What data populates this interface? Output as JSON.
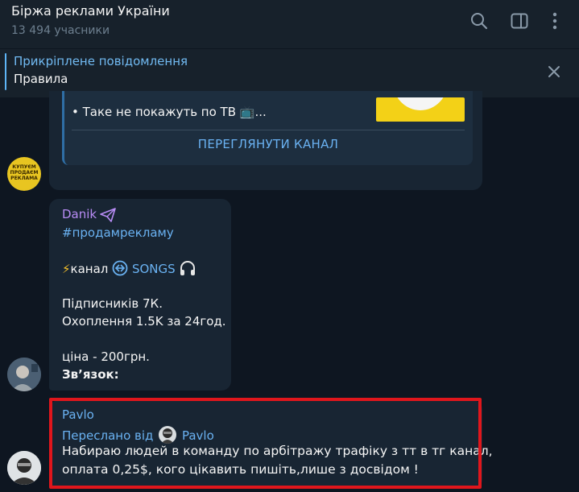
{
  "header": {
    "title": "Біржа реклами України",
    "subtitle": "13 494 учасники",
    "icons": [
      "search-icon",
      "sidebar-toggle-icon",
      "more-vertical-icon"
    ]
  },
  "pinned": {
    "label": "Прикріплене повідомлення",
    "text": "Правила",
    "close_icon": "close-icon"
  },
  "message1": {
    "card_line": "• Таке не покажуть по ТВ 📺...",
    "button": "ПЕРЕГЛЯНУТИ КАНАЛ",
    "avatar_text": "КУПУЄМ ПРОДАЄМ РЕКЛАМА"
  },
  "message2": {
    "sender": "Danik",
    "hashtag": "#продамрекламу",
    "channel_prefix": "канал",
    "channel_name": "SONGS",
    "subscribers": "Підписників 7К.",
    "reach": "Охоплення 1.5K за 24год.",
    "price": "ціна - 200грн.",
    "contact": "Зв’язок:"
  },
  "message3": {
    "sender": "Pavlo",
    "forwarded_prefix": "Переслано від",
    "forwarded_name": "Pavlo",
    "text_line1": "Набираю людей в команду по арбітражу трафіку з тт в тг канал,",
    "text_line2": "оплата 0,25$, кого цікавить пишіть,лише з досвідом !"
  },
  "colors": {
    "background": "#0e1621",
    "bubble": "#182533",
    "accent": "#6ab2f2",
    "highlight_frame": "#e0161c"
  }
}
